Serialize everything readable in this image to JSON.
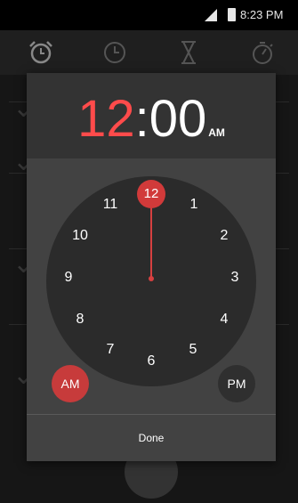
{
  "status_bar": {
    "time": "8:23 PM"
  },
  "tabs": [
    {
      "icon": "alarm-icon"
    },
    {
      "icon": "clock-icon"
    },
    {
      "icon": "timer-icon"
    },
    {
      "icon": "stopwatch-icon"
    }
  ],
  "time_picker": {
    "hour": "12",
    "separator": ":",
    "minute": "00",
    "period": "AM",
    "selected_hour": "12",
    "clock_numbers": [
      "12",
      "1",
      "2",
      "3",
      "4",
      "5",
      "6",
      "7",
      "8",
      "9",
      "10",
      "11"
    ],
    "am_label": "AM",
    "pm_label": "PM",
    "done_label": "Done"
  },
  "colors": {
    "accent": "#d74040",
    "dialog": "#424242",
    "face": "#2b2b2b"
  }
}
